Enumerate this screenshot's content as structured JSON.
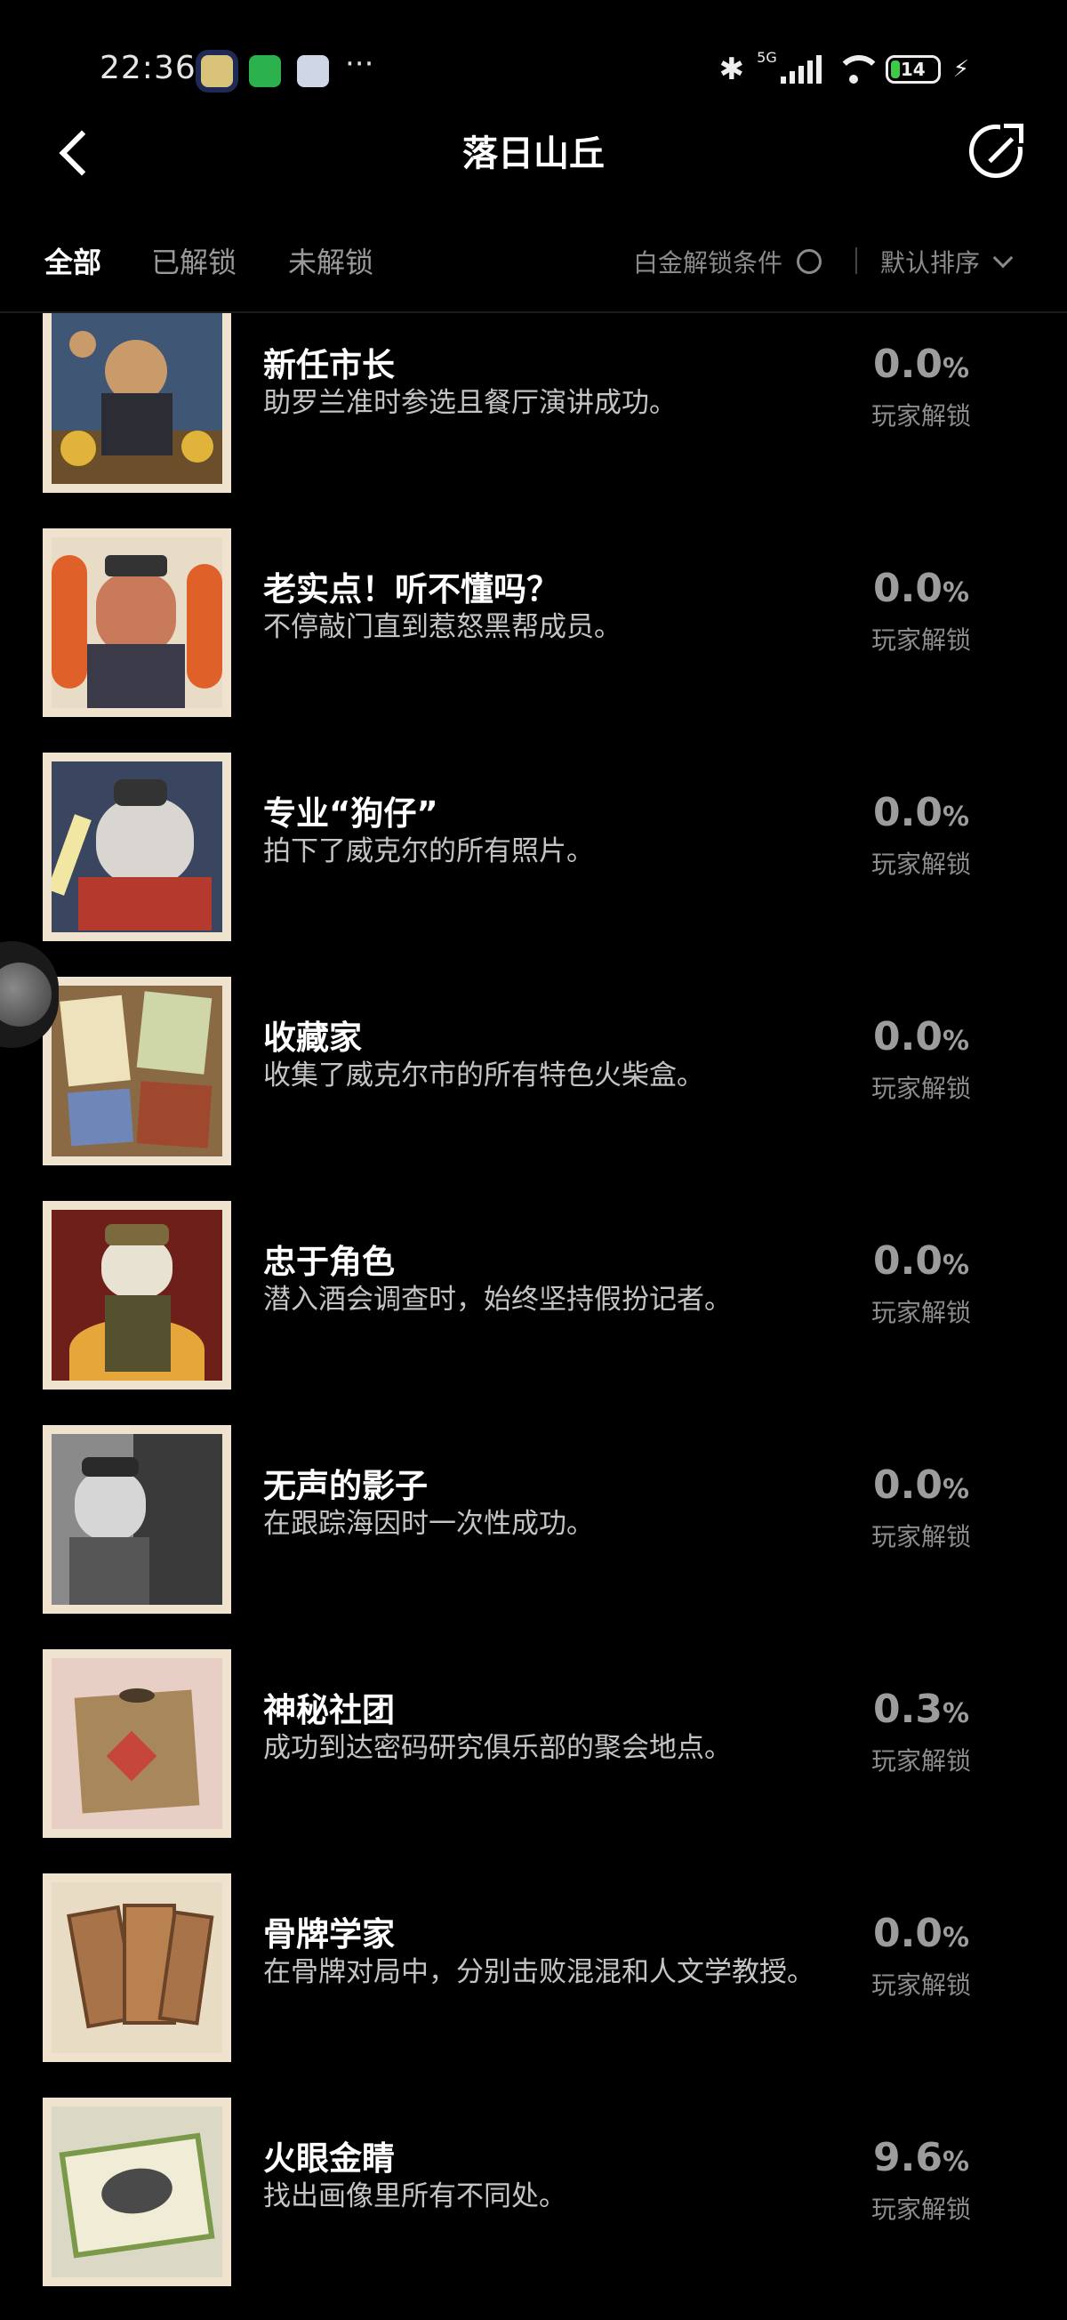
{
  "status_bar": {
    "time": "22:36",
    "network": "5G",
    "battery": "14",
    "more": "···"
  },
  "header": {
    "title": "落日山丘"
  },
  "tabs": [
    {
      "label": "全部",
      "active": true
    },
    {
      "label": "已解锁",
      "active": false
    },
    {
      "label": "未解锁",
      "active": false
    }
  ],
  "filter": {
    "platinum_label": "白金解锁条件",
    "sort_label": "默认排序"
  },
  "achievements": [
    {
      "title": "新任市长",
      "desc": "助罗兰准时参选且餐厅演讲成功。",
      "pct": "0.0",
      "unit": "%",
      "label": "玩家解锁"
    },
    {
      "title": "老实点！听不懂吗？",
      "desc": "不停敲门直到惹怒黑帮成员。",
      "pct": "0.0",
      "unit": "%",
      "label": "玩家解锁"
    },
    {
      "title": "专业“狗仔”",
      "desc": "拍下了威克尔的所有照片。",
      "pct": "0.0",
      "unit": "%",
      "label": "玩家解锁"
    },
    {
      "title": "收藏家",
      "desc": "收集了威克尔市的所有特色火柴盒。",
      "pct": "0.0",
      "unit": "%",
      "label": "玩家解锁"
    },
    {
      "title": "忠于角色",
      "desc": "潜入酒会调查时，始终坚持假扮记者。",
      "pct": "0.0",
      "unit": "%",
      "label": "玩家解锁"
    },
    {
      "title": "无声的影子",
      "desc": "在跟踪海因时一次性成功。",
      "pct": "0.0",
      "unit": "%",
      "label": "玩家解锁"
    },
    {
      "title": "神秘社团",
      "desc": "成功到达密码研究俱乐部的聚会地点。",
      "pct": "0.3",
      "unit": "%",
      "label": "玩家解锁"
    },
    {
      "title": "骨牌学家",
      "desc": "在骨牌对局中，分别击败混混和人文学教授。",
      "pct": "0.0",
      "unit": "%",
      "label": "玩家解锁"
    },
    {
      "title": "火眼金睛",
      "desc": "找出画像里所有不同处。",
      "pct": "9.6",
      "unit": "%",
      "label": "玩家解锁"
    }
  ]
}
